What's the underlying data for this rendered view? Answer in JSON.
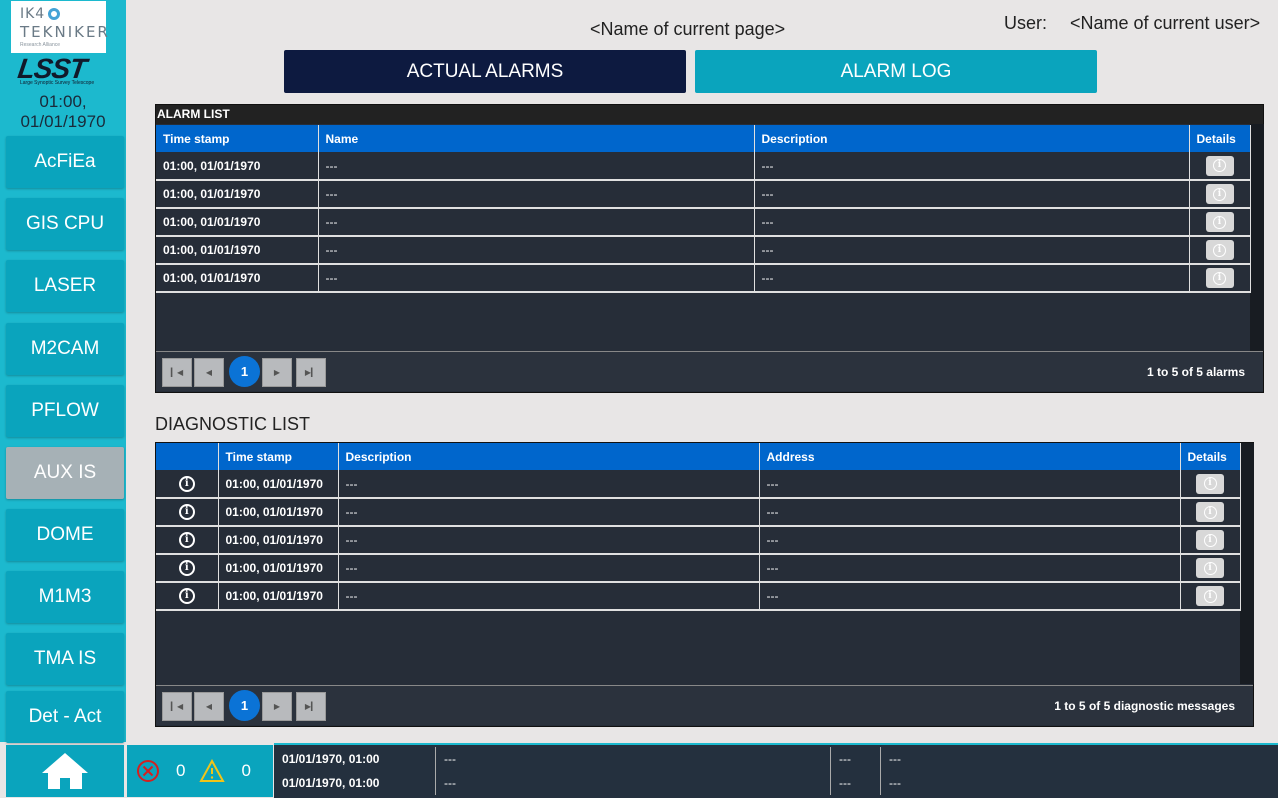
{
  "sidebar": {
    "logo_ik4_line1": "IK4",
    "logo_ik4_line2": "TEKNIKER",
    "logo_ik4_line3": "Research Alliance",
    "logo_lsst": "LSST",
    "logo_lsst_sub": "Large Synoptic Survey Telescope",
    "time": "01:00,",
    "date": "01/01/1970",
    "items": [
      {
        "label": "AcFiEa",
        "active": false
      },
      {
        "label": "GIS CPU",
        "active": false
      },
      {
        "label": "LASER",
        "active": false
      },
      {
        "label": "M2CAM",
        "active": false
      },
      {
        "label": "PFLOW",
        "active": false
      },
      {
        "label": "AUX IS",
        "active": true
      },
      {
        "label": "DOME",
        "active": false
      },
      {
        "label": "M1M3",
        "active": false
      },
      {
        "label": "TMA IS",
        "active": false
      },
      {
        "label": "Det - Act",
        "active": false
      }
    ],
    "home_icon": "home-icon"
  },
  "header": {
    "page_name": "<Name of current page>",
    "user_label": "User:",
    "user_name": "<Name of current user>"
  },
  "tabs": {
    "actual_alarms": "ACTUAL ALARMS",
    "alarm_log": "ALARM LOG"
  },
  "alarm_list": {
    "title": "ALARM LIST",
    "columns": [
      "Time stamp",
      "Name",
      "Description",
      "Details"
    ],
    "rows": [
      {
        "timestamp": "01:00, 01/01/1970",
        "name": "---",
        "description": "---"
      },
      {
        "timestamp": "01:00, 01/01/1970",
        "name": "---",
        "description": "---"
      },
      {
        "timestamp": "01:00, 01/01/1970",
        "name": "---",
        "description": "---"
      },
      {
        "timestamp": "01:00, 01/01/1970",
        "name": "---",
        "description": "---"
      },
      {
        "timestamp": "01:00, 01/01/1970",
        "name": "---",
        "description": "---"
      }
    ],
    "pager": {
      "current_page": "1",
      "info": "1 to 5 of 5 alarms"
    }
  },
  "diagnostic_list": {
    "title": "DIAGNOSTIC LIST",
    "columns": [
      "",
      "Time stamp",
      "Description",
      "Address",
      "Details"
    ],
    "rows": [
      {
        "timestamp": "01:00, 01/01/1970",
        "description": "---",
        "address": "---"
      },
      {
        "timestamp": "01:00, 01/01/1970",
        "description": "---",
        "address": "---"
      },
      {
        "timestamp": "01:00, 01/01/1970",
        "description": "---",
        "address": "---"
      },
      {
        "timestamp": "01:00, 01/01/1970",
        "description": "---",
        "address": "---"
      },
      {
        "timestamp": "01:00, 01/01/1970",
        "description": "---",
        "address": "---"
      }
    ],
    "pager": {
      "current_page": "1",
      "info": "1 to 5 of 5 diagnostic messages"
    }
  },
  "footer": {
    "error_count": "0",
    "warning_count": "0",
    "log": [
      {
        "timestamp": "01/01/1970, 01:00",
        "message": "---",
        "col3": "---",
        "col4": "---"
      },
      {
        "timestamp": "01/01/1970, 01:00",
        "message": "---",
        "col3": "---",
        "col4": "---"
      }
    ]
  },
  "colors": {
    "sidebar": "#1cb9ce",
    "button": "#0aa4bd",
    "active_tab": "#0d1a40",
    "table_header": "#0066cc",
    "panel_bg": "#262d38"
  }
}
